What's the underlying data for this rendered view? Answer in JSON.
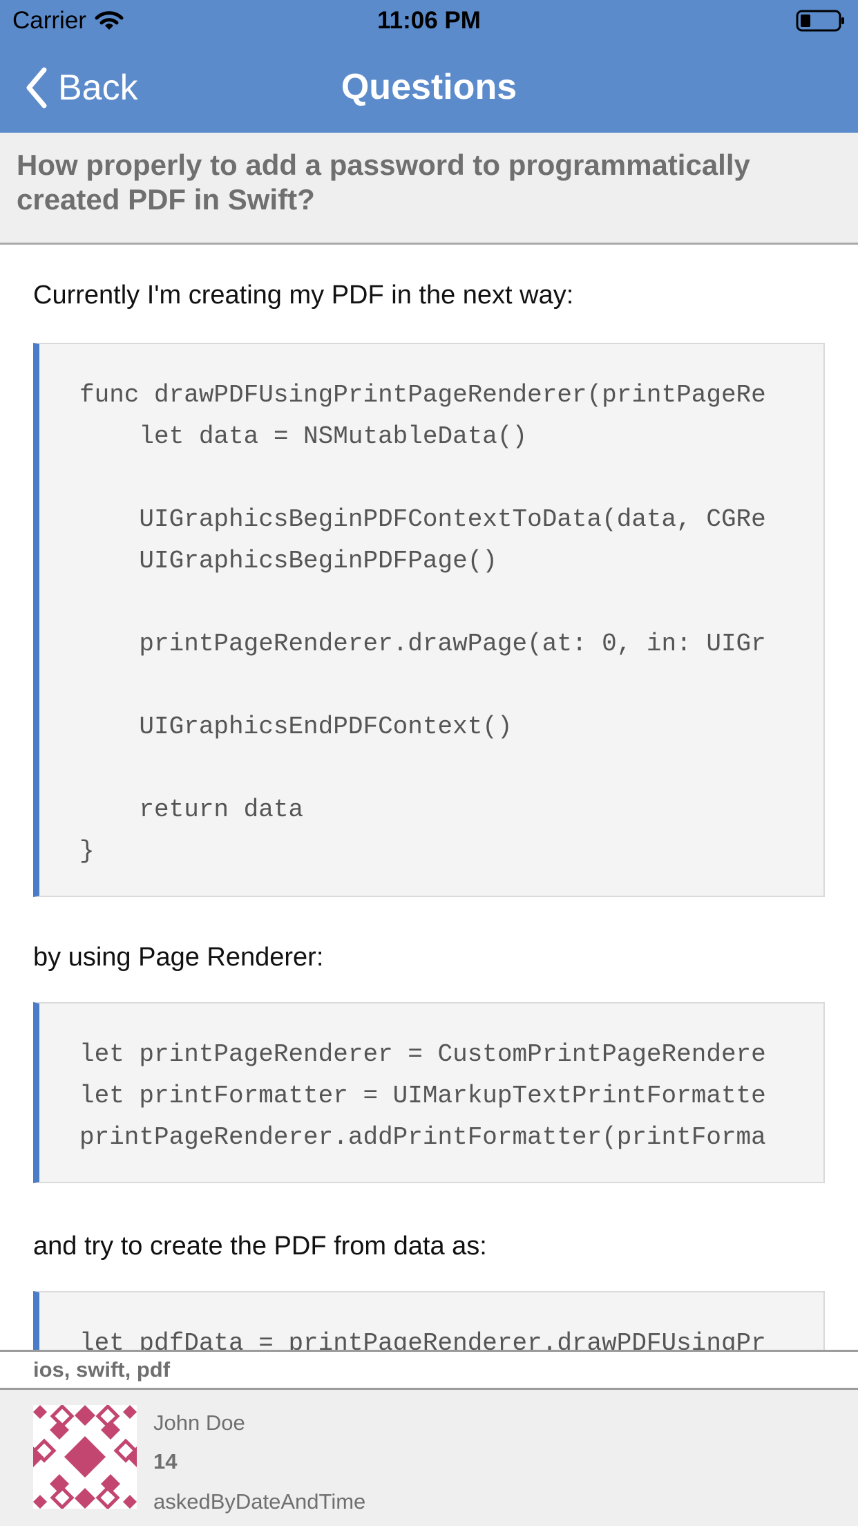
{
  "status_bar": {
    "carrier": "Carrier",
    "time": "11:06 PM"
  },
  "nav": {
    "back_label": "Back",
    "title": "Questions"
  },
  "question": {
    "title": "How properly to add a password to programmatically created PDF in Swift?",
    "para1": "Currently I'm creating my PDF in the next way:",
    "code1": "func drawPDFUsingPrintPageRenderer(printPageRe\n    let data = NSMutableData()\n\n    UIGraphicsBeginPDFContextToData(data, CGRe\n    UIGraphicsBeginPDFPage()\n\n    printPageRenderer.drawPage(at: 0, in: UIGr\n\n    UIGraphicsEndPDFContext()\n\n    return data\n}",
    "para2": "by using Page Renderer:",
    "code2": "let printPageRenderer = CustomPrintPageRendere\nlet printFormatter = UIMarkupTextPrintFormatte\nprintPageRenderer.addPrintFormatter(printForma",
    "para3": "and try to create the PDF from data as:",
    "code3": "let pdfData = printPageRenderer.drawPDFUsingPr"
  },
  "tags": "ios, swift, pdf",
  "user": {
    "name": "John Doe",
    "reputation": "14",
    "asked": "askedByDateAndTime"
  },
  "colors": {
    "nav": "#5b8bcb",
    "code_accent": "#4a7cc7",
    "avatar": "#c2466f"
  }
}
